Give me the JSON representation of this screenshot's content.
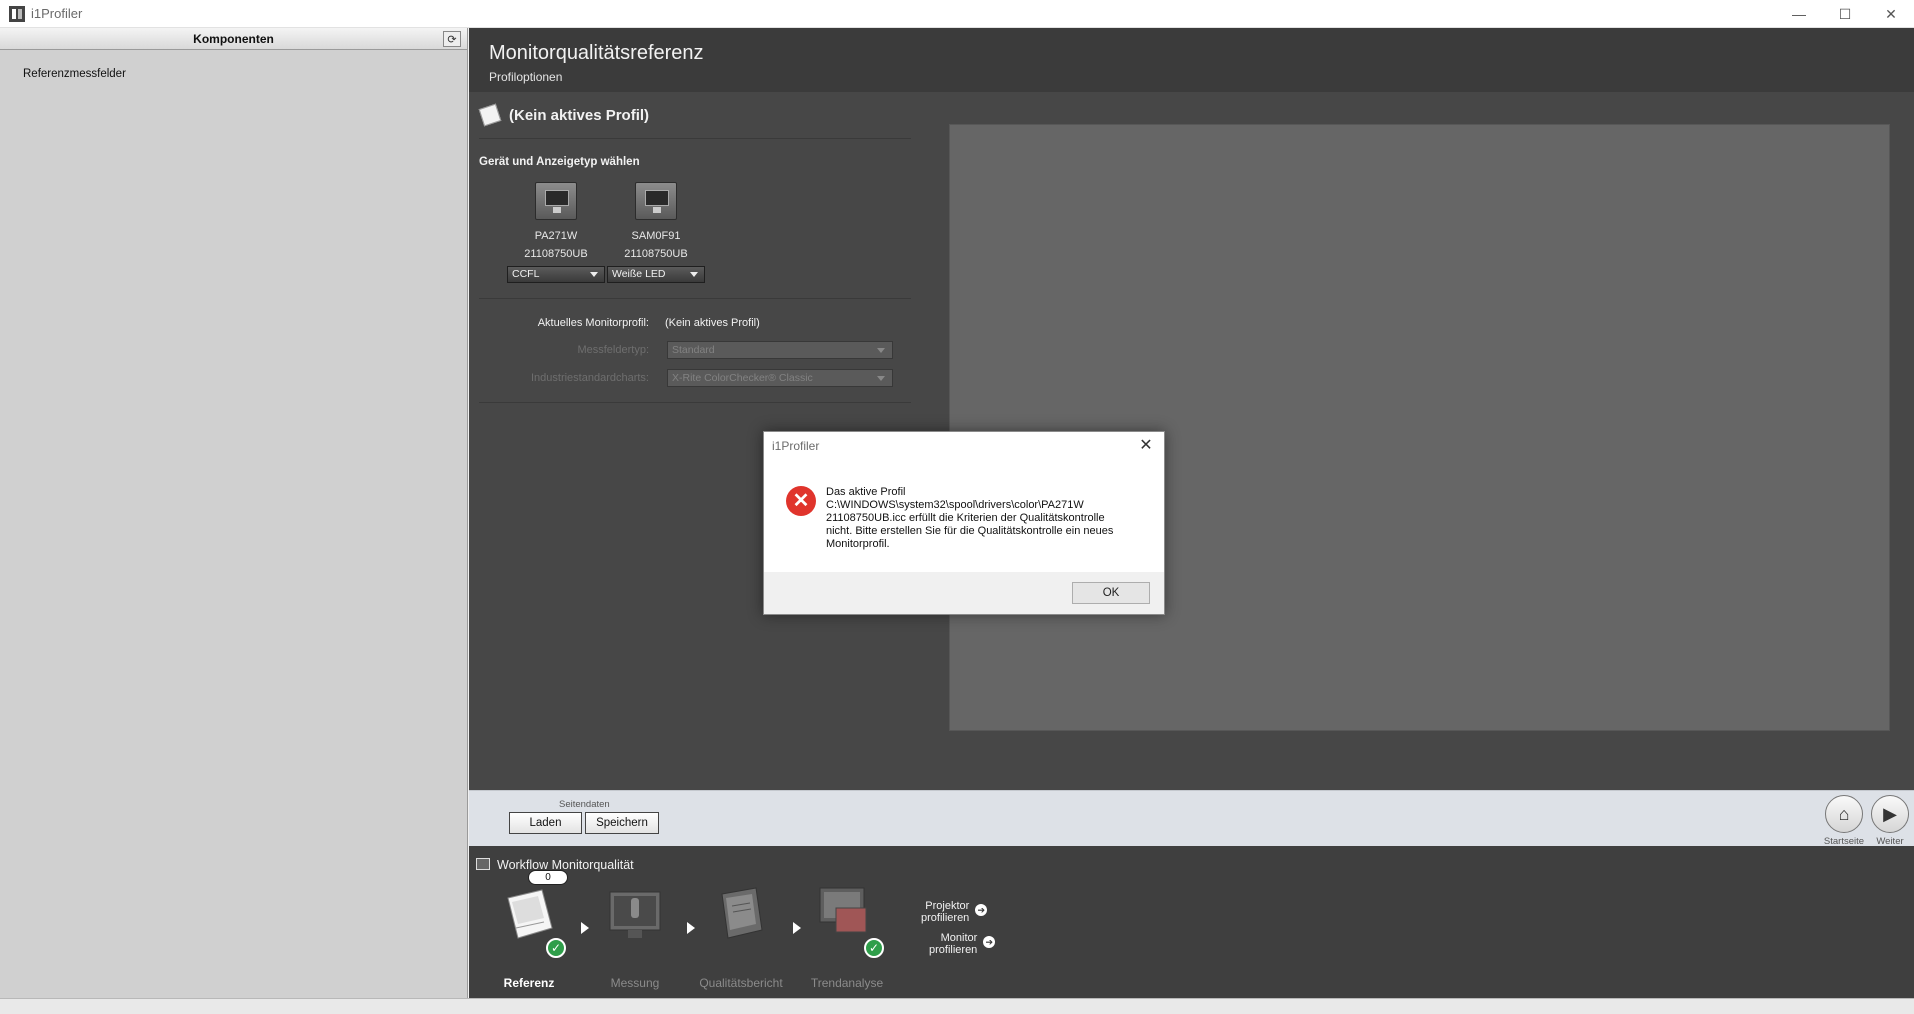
{
  "window": {
    "title": "i1Profiler",
    "minimize": "—",
    "maximize": "☐",
    "close": "✕"
  },
  "left_panel": {
    "header": "Komponenten",
    "refresh_icon": "⟳",
    "items": [
      "Referenzmessfelder"
    ]
  },
  "main": {
    "title": "Monitorqualitätsreferenz",
    "subtitle": "Profiloptionen",
    "profile_status": "(Kein aktives Profil)",
    "device_section_title": "Gerät und Anzeigetyp wählen",
    "devices": [
      {
        "name": "PA271W",
        "serial": "21108750UB",
        "type": "CCFL"
      },
      {
        "name": "SAM0F91",
        "serial": "21108750UB",
        "type": "Weiße LED"
      }
    ],
    "current_profile_label": "Aktuelles Monitorprofil:",
    "current_profile_value": "(Kein aktives Profil)",
    "patch_type_label": "Messfeldertyp:",
    "patch_type_value": "Standard",
    "industry_chart_label": "Industriestandardcharts:",
    "industry_chart_value": "X-Rite ColorChecker® Classic"
  },
  "page_data_bar": {
    "label": "Seitendaten",
    "load": "Laden",
    "save": "Speichern",
    "home_label": "Startseite",
    "next_label": "Weiter",
    "home_icon": "⌂",
    "next_icon": "▶"
  },
  "workflow": {
    "title": "Workflow Monitorqualität",
    "counter": "0",
    "steps": [
      {
        "label": "Referenz"
      },
      {
        "label": "Messung"
      },
      {
        "label": "Qualitätsbericht"
      },
      {
        "label": "Trendanalyse"
      }
    ],
    "links": [
      {
        "line1": "Projektor",
        "line2": "profilieren"
      },
      {
        "line1": "Monitor",
        "line2": "profilieren"
      }
    ],
    "check_icon": "✓"
  },
  "dialog": {
    "title": "i1Profiler",
    "close": "✕",
    "error_icon": "✕",
    "lines": [
      "Das aktive Profil",
      "C:\\WINDOWS\\system32\\spool\\drivers\\color\\PA271W",
      "21108750UB.icc erfüllt die Kriterien der Qualitätskontrolle",
      "nicht. Bitte erstellen Sie für die Qualitätskontrolle ein neues",
      "Monitorprofil."
    ],
    "ok": "OK"
  }
}
